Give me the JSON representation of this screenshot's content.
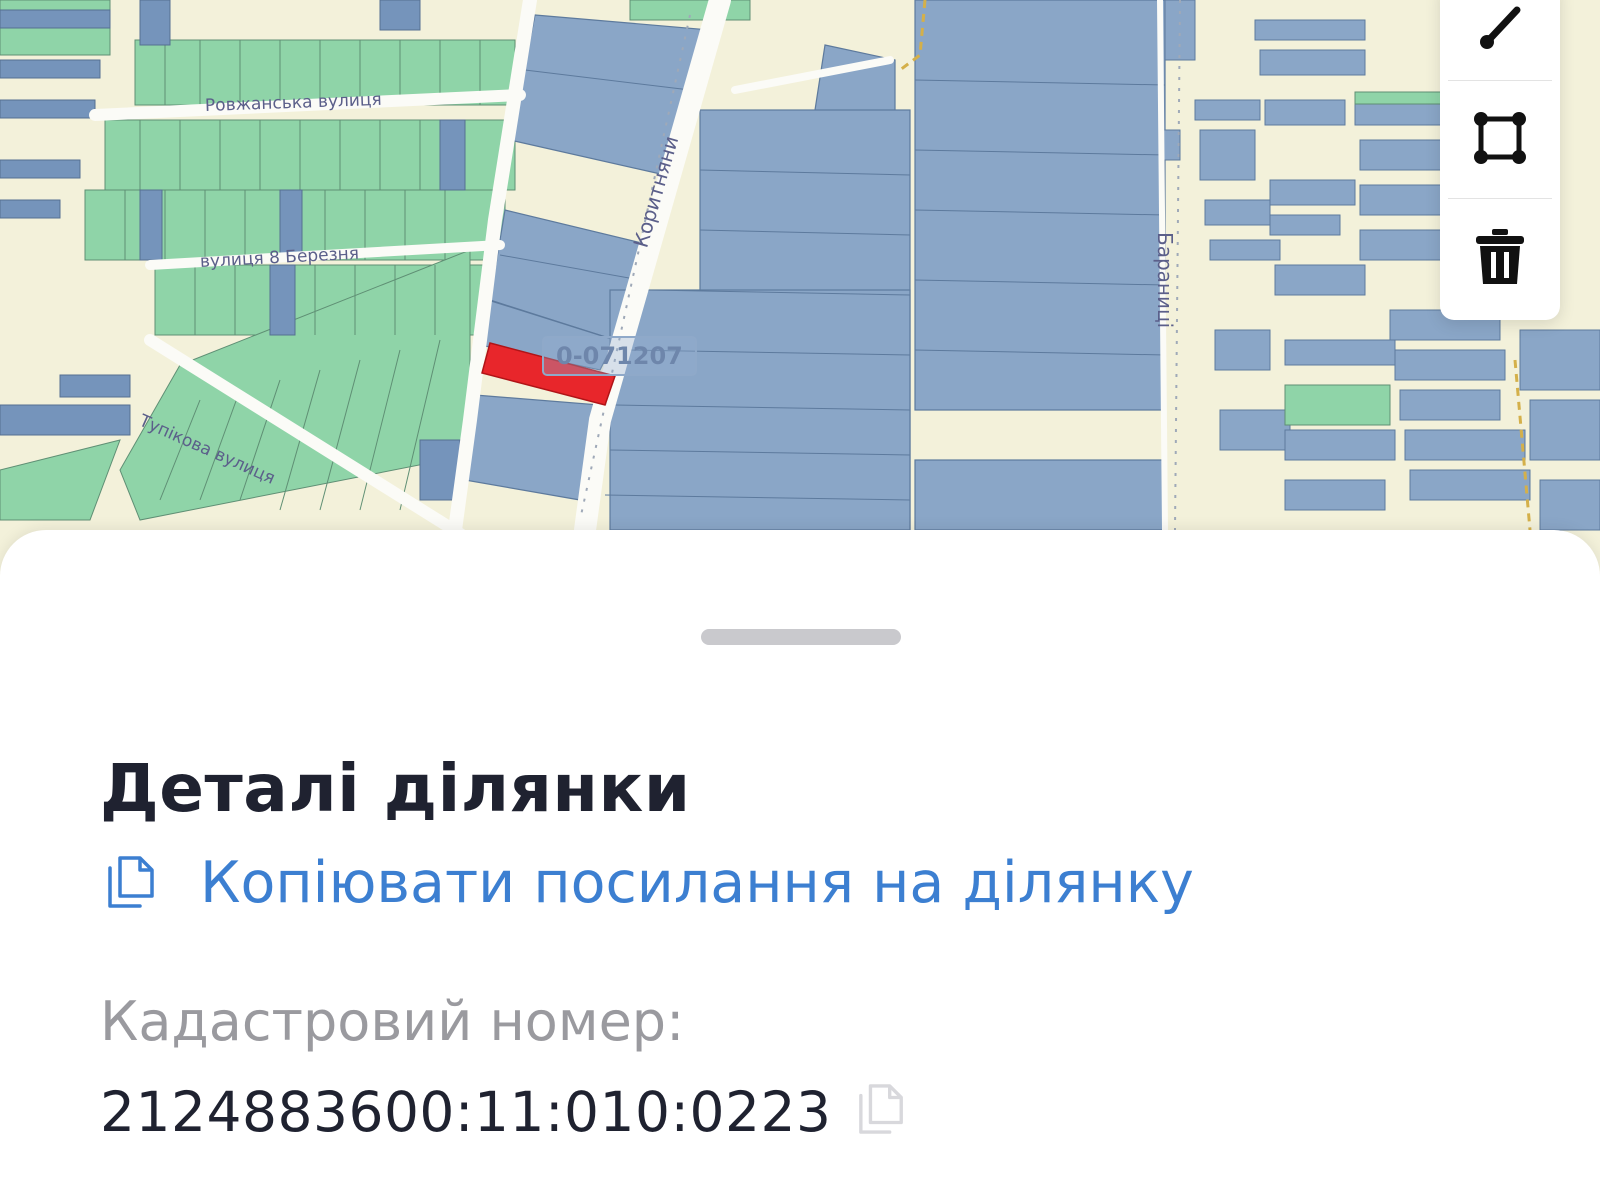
{
  "map": {
    "streets": {
      "rovzhanska": "Ровжанська вулиця",
      "berezia": "вулиця 8 Березня",
      "tupikova": "Тупікова вулиця",
      "korytniany": "Коритняни",
      "baranyntsi": "Бараниці"
    },
    "zone_label": "0-071207",
    "colors": {
      "background": "#f3f1da",
      "parcel_blue": "#8aa6c7",
      "parcel_blue_dark": "#7594bb",
      "parcel_green": "#8fd4a8",
      "selected_parcel": "#e8262b",
      "road": "#f7f7f2"
    }
  },
  "toolbar": {
    "icons": [
      "edit-pen-icon",
      "polygon-icon",
      "trash-icon"
    ]
  },
  "sheet": {
    "title": "Деталі ділянки",
    "copy_link_label": "Копіювати посилання на ділянку",
    "cadastral_label": "Кадастровий номер:",
    "cadastral_number": "2124883600:11:010:0223",
    "colors": {
      "link": "#3c7fd1",
      "title": "#1f2230",
      "label": "#9a9a9f"
    }
  }
}
